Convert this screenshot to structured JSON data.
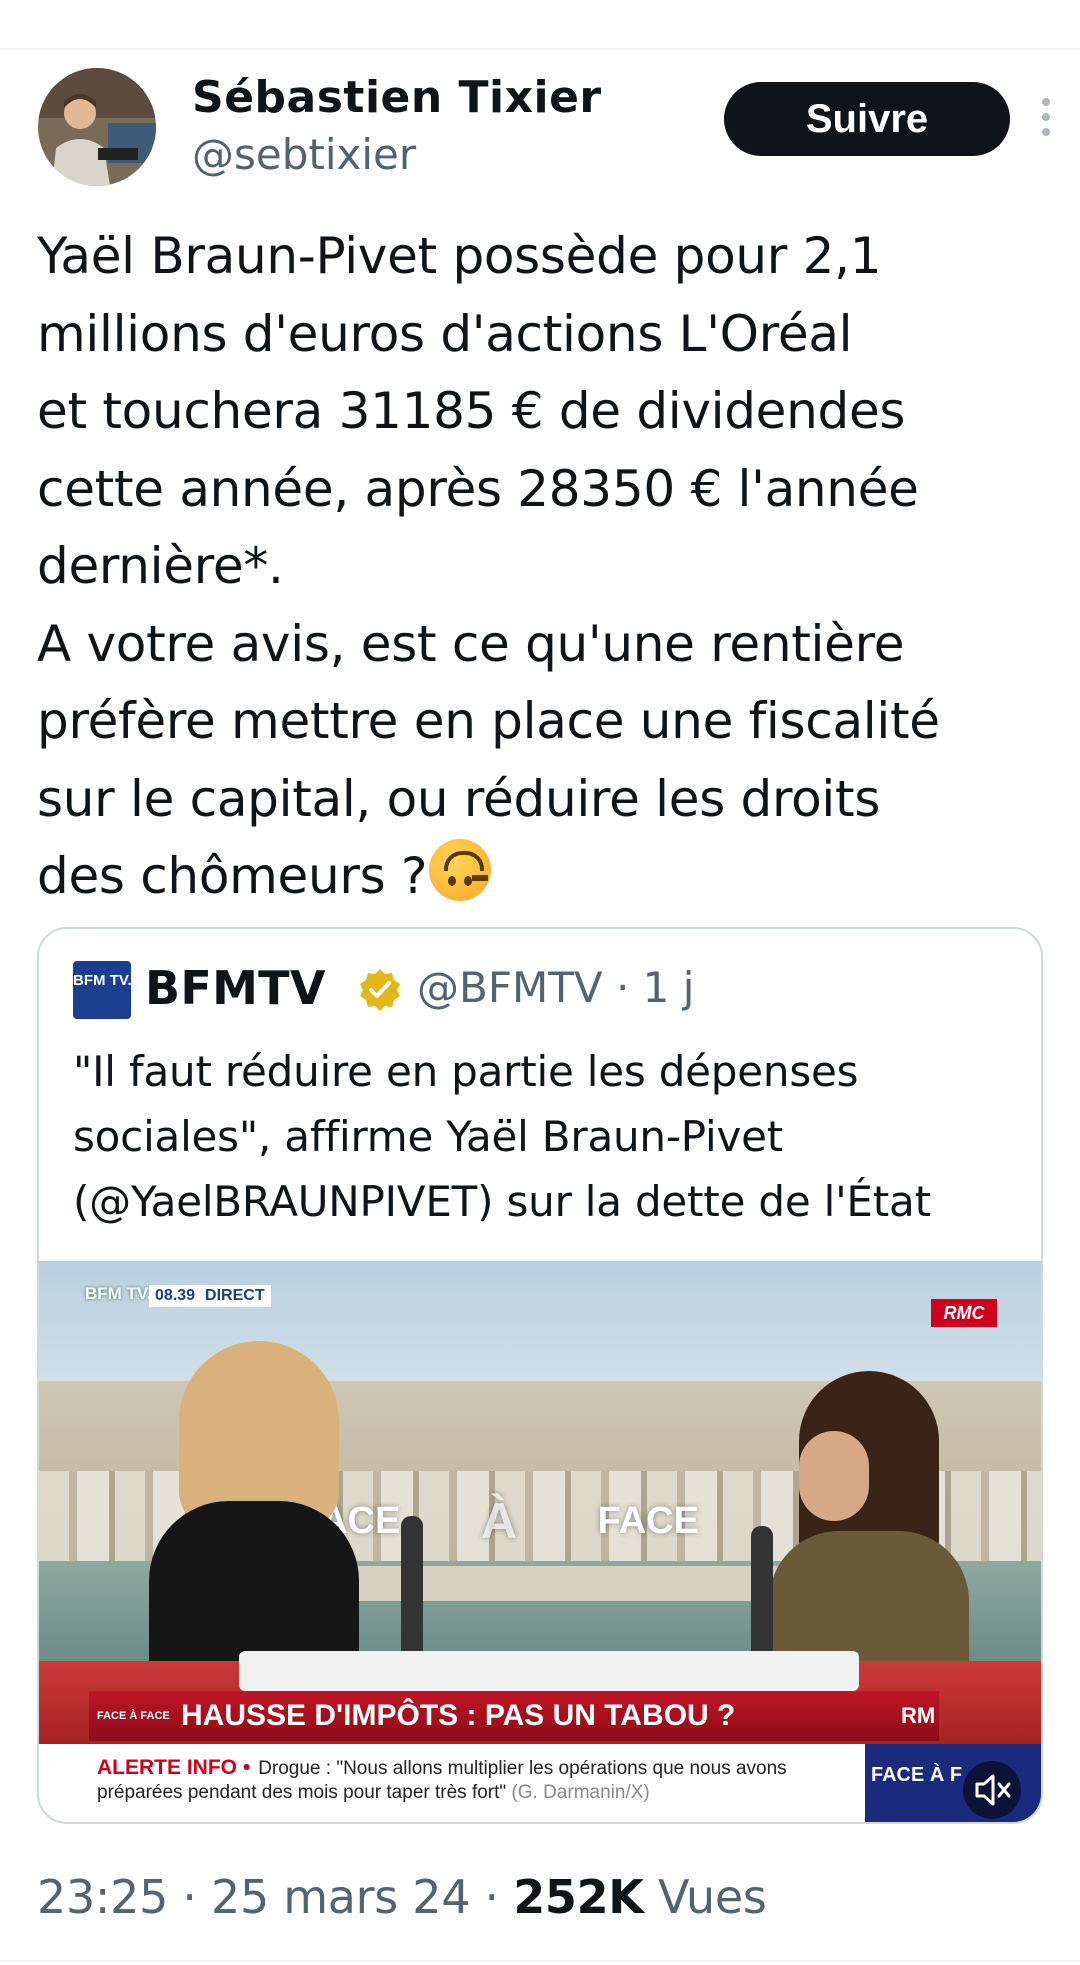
{
  "author": {
    "name": "Sébastien Tixier",
    "handle": "@sebtixier",
    "follow_label": "Suivre"
  },
  "tweet": {
    "text": "Yaël Braun-Pivet possède pour 2,1\nmillions d'euros d'actions L'Oréal\net touchera 31185 € de dividendes\ncette année, après 28350 € l'année\ndernière*.\nA votre avis, est ce qu'une rentière\npréfère mettre en place une fiscalité\nsur le capital, ou réduire les droits\ndes chômeurs ?",
    "emoji": "upside-down-face"
  },
  "quote": {
    "logo_text": "BFM TV.",
    "name": "BFMTV",
    "handle_time": "@BFMTV · 1 j",
    "verified_color": "#e2b719",
    "text": "\"Il faut réduire en partie les dépenses\nsociales\", affirme Yaël Braun-Pivet\n(@YaelBRAUNPIVET) sur la dette de l'État",
    "video": {
      "channel_logo": "BFM TV.",
      "time": "08.39",
      "live": "DIRECT",
      "rmc": "RMC",
      "face_a_face": [
        "FACE",
        "À",
        "FACE"
      ],
      "banner_tag": "FACE À FACE",
      "banner": "HAUSSE D'IMPÔTS : PAS UN TABOU ?",
      "banner_right": "RM",
      "alert": "ALERTE INFO •",
      "ticker": "Drogue : \"Nous allons multiplier les opérations que nous avons préparées pendant des mois pour taper très fort\"",
      "ticker_source": "(G. Darmanin/X)",
      "corner": "FACE À F"
    }
  },
  "footer": {
    "time_date": "23:25 · 25 mars 24 · ",
    "views_count": "252K",
    "views_label": " Vues"
  }
}
